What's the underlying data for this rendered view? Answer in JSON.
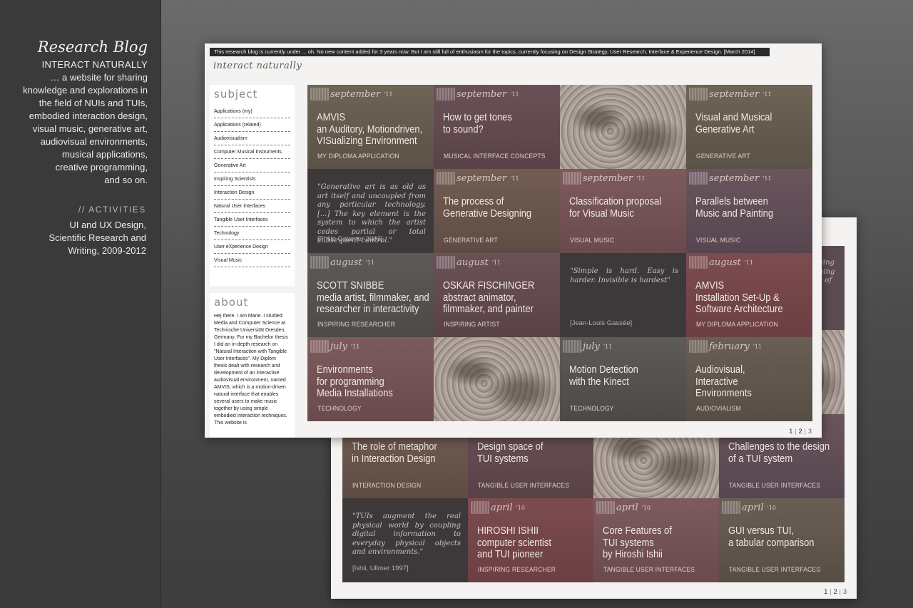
{
  "sidebar": {
    "title": "Research Blog",
    "subtitle": "INTERACT NATURALLY",
    "desc_lines": [
      "… a website for sharing",
      "knowledge and explorations in",
      "the field of NUIs and TUIs,",
      "embodied interaction design,",
      "visual music, generative art,",
      "audiovisual environments,",
      "musical applications,",
      "creative programming,",
      "and so on."
    ],
    "activities_heading": "// ACTIVITIES",
    "activities_lines": [
      "UI and UX Design,",
      "Scientific Research and",
      "Writing, 2009-2012"
    ]
  },
  "front": {
    "banner": "This research blog is currently under ... oh. No new content added for 3 years now. But I am still full of enthusiasm for the topics, currently focusing on Design Strategy, User Research, Interface & Experience Design. [March 2014]",
    "logo": "interact naturally",
    "subject_heading": "subject",
    "subjects": [
      "Applications (my)",
      "Applications (related)",
      "Audiovisualism",
      "Computer Musical Instruments",
      "Generative Art",
      "Inspiring Scientists",
      "Interaction Design",
      "Natural User Interfaces",
      "Tangible User Interfaces",
      "Technology",
      "User eXperience Design",
      "Visual Music"
    ],
    "about_heading": "about",
    "about_text": "Hej there. I am Marie. I studied Media and Computer Science at Technische Universität Dresden, Germany. For my Bachelor thesis I did an in-depth research on \"Natural Interaction with Tangible User Interfaces\". My Diplom thesis dealt with research and development of an interactive audiovisual environment, named AMVIS, which is a motion-driven natural interface that enables several users to make music together by using simple embodied interaction techniques. This website is",
    "tiles": [
      {
        "type": "post",
        "color": "olive",
        "month": "september",
        "year": "'11",
        "title": "AMVIS\nan Auditory, Motiondriven,\nVISualizing Environment",
        "category": "MY DIPLOMA APPLICATION"
      },
      {
        "type": "post",
        "color": "mauve",
        "month": "september",
        "year": "'11",
        "title": "How to get tones\nto sound?",
        "category": "MUSICAL INTERFACE CONCEPTS"
      },
      {
        "type": "photo"
      },
      {
        "type": "post",
        "color": "olive",
        "month": "september",
        "year": "'11",
        "title": "Visual and Musical\nGenerative Art",
        "category": "GENERATIVE ART"
      },
      {
        "type": "quote",
        "text": "\"Generative  art is as old as art itself and uncoupled from any particular technology. [...] The key element is the system to which the artist cedes partial or total subsequent control.\"",
        "source": "[Philip Galanter 2003]"
      },
      {
        "type": "post",
        "color": "brown",
        "month": "september",
        "year": "'11",
        "title": "The process of\nGenerative Designing",
        "category": "GENERATIVE ART"
      },
      {
        "type": "post",
        "color": "rose",
        "month": "september",
        "year": "'11",
        "title": "Classification proposal\nfor Visual Music",
        "category": "VISUAL MUSIC"
      },
      {
        "type": "post",
        "color": "plum",
        "month": "september",
        "year": "'11",
        "title": "Parallels between\nMusic and Painting",
        "category": "VISUAL MUSIC"
      },
      {
        "type": "post",
        "color": "grey",
        "month": "august",
        "year": "'11",
        "title": "SCOTT SNIBBE\nmedia artist, filmmaker, and\nresearcher in interactivity",
        "category": "INSPIRING RESEARCHER"
      },
      {
        "type": "post",
        "color": "mauve",
        "month": "august",
        "year": "'11",
        "title": "OSKAR FISCHINGER\nabstract animator,\nfilmmaker, and painter",
        "category": "INSPIRING ARTIST"
      },
      {
        "type": "quote",
        "text": "\"Simple is hard.\nEasy is harder.\nInvisible is hardest\"",
        "source": "[Jean-Louis Gassée]"
      },
      {
        "type": "post",
        "color": "red",
        "month": "august",
        "year": "'11",
        "title": "AMVIS\nInstallation Set-Up &\nSoftware Architecture",
        "category": "MY DIPLOMA APPLICATION"
      },
      {
        "type": "post",
        "color": "rose",
        "month": "july",
        "year": "'11",
        "title": "Environments\nfor programming\nMedia Installations",
        "category": "TECHNOLOGY"
      },
      {
        "type": "photo"
      },
      {
        "type": "post",
        "color": "grey",
        "month": "july",
        "year": "'11",
        "title": "Motion Detection\nwith the Kinect",
        "category": "TECHNOLOGY"
      },
      {
        "type": "post",
        "color": "taupe",
        "month": "february",
        "year": "'11",
        "title": "Audiovisual,\nInteractive\nEnvironments",
        "category": "AUDIOVIALISM"
      }
    ],
    "pager": [
      "1",
      "2",
      "3"
    ]
  },
  "back": {
    "tiles": [
      {
        "type": "post",
        "color": "brown",
        "month": "",
        "year": "",
        "title": "The role of metaphor\nin Interaction Design",
        "category": "INTERACTION DESIGN"
      },
      {
        "type": "post",
        "color": "mauve",
        "month": "",
        "year": "",
        "title": "Design space of\nTUI systems",
        "category": "TANGIBLE USER INTERFACES"
      },
      {
        "type": "photo"
      },
      {
        "type": "post",
        "color": "plum",
        "month": "",
        "year": "",
        "title": "Challenges to the design\nof a TUI system",
        "category": "TANGIBLE USER INTERFACES"
      },
      {
        "type": "quote",
        "text": "\"TUIs  augment  the  real  physical world by coupling digital information to everyday physical objects and environments.\"",
        "source": "[Ishii, Ullmer 1997]"
      },
      {
        "type": "post",
        "color": "red",
        "month": "april",
        "year": "'10",
        "title": "HIROSHI ISHII\ncomputer scientist\nand TUI pioneer",
        "category": "INSPIRING RESEARCHER"
      },
      {
        "type": "post",
        "color": "rose",
        "month": "april",
        "year": "'10",
        "title": "Core Features of\nTUI systems\nby Hiroshi Ishii",
        "category": "TANGIBLE USER INTERFACES"
      },
      {
        "type": "post",
        "color": "taupe",
        "month": "april",
        "year": "'10",
        "title": "GUI versus TUI,\na tabular comparison",
        "category": "TANGIBLE USER INTERFACES"
      }
    ],
    "peek_text": "eing\nhing\ns of",
    "pager": [
      "1",
      "2",
      "3"
    ]
  }
}
